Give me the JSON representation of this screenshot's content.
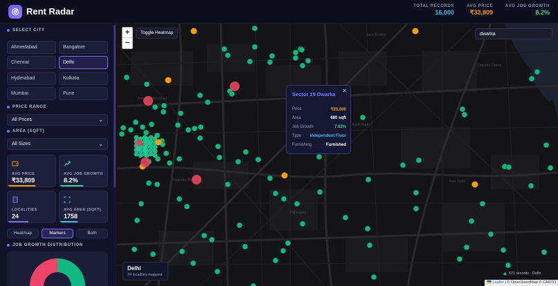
{
  "app": {
    "title": "Rent Radar"
  },
  "header_stats": [
    {
      "label": "TOTAL RECORDS",
      "value": "16,000",
      "color": "#38bdf8"
    },
    {
      "label": "AVG PRICE",
      "value": "₹33,809",
      "color": "#f59e0b"
    },
    {
      "label": "AVG JOB GROWTH",
      "value": "8.2%",
      "color": "#34d399"
    }
  ],
  "sidebar": {
    "select_city_title": "SELECT CITY",
    "cities": [
      "Ahmedabad",
      "Bangalore",
      "Chennai",
      "Delhi",
      "Hyderabad",
      "Kolkata",
      "Mumbai",
      "Pune"
    ],
    "active_city": "Delhi",
    "price_range_title": "PRICE RANGE",
    "price_select": "All Prices",
    "area_title": "AREA (SQFT)",
    "area_select": "All Sizes",
    "cards": [
      {
        "label": "AVG PRICE",
        "value": "₹33,809",
        "icon": "wallet-icon",
        "color": "#f59e0b"
      },
      {
        "label": "AVG JOB GROWTH",
        "value": "8.2%",
        "icon": "trend-up-icon",
        "color": "#34d399"
      },
      {
        "label": "LOCALITIES",
        "value": "24",
        "icon": "building-icon",
        "color": "#7c6df9"
      },
      {
        "label": "AVG AREA (SQFT)",
        "value": "1758",
        "icon": "area-icon",
        "color": "#38bdf8"
      }
    ],
    "modes": [
      "Heatmap",
      "Markers",
      "Both"
    ],
    "active_mode": "Markers",
    "job_growth_title": "JOB GROWTH DISTRIBUTION"
  },
  "map": {
    "toggle_heatmap": "Toggle Heatmap",
    "zoom_in": "+",
    "zoom_out": "−",
    "search_value": "dwarka",
    "popup": {
      "title": "Sector 19 Dwarka",
      "close": "✕",
      "rows": [
        {
          "key": "Price",
          "value": "₹25,000",
          "color": "#f59e0b"
        },
        {
          "key": "Area",
          "value": "680 sqft",
          "color": "#ffffff"
        },
        {
          "key": "Job Growth",
          "value": "7.62%",
          "color": "#34d399"
        },
        {
          "key": "Type",
          "value": "Independent Floor",
          "color": "#38bdf8"
        },
        {
          "key": "Furnishing",
          "value": "Furnished",
          "color": "#ffffff"
        }
      ]
    },
    "info_city": "Delhi",
    "info_sub": "24 localities mapped",
    "records_text": "571 records · Delhi",
    "attribution_flag": "🇺🇦",
    "attribution_leaflet": "Leaflet",
    "attribution_rest": "| © OpenStreetMap © CARTO",
    "street_labels": [
      "Bahadurgarh Road",
      "Sarai Rohilla",
      "Chandni Chowk",
      "Karol Bagh",
      "Rajendra Place",
      "Paharganj",
      "New Delhi"
    ]
  },
  "colors": {
    "accent": "#7c6df9",
    "green_marker": "#10b981",
    "orange_marker": "#f59e0b",
    "red_marker": "#e3435a"
  }
}
